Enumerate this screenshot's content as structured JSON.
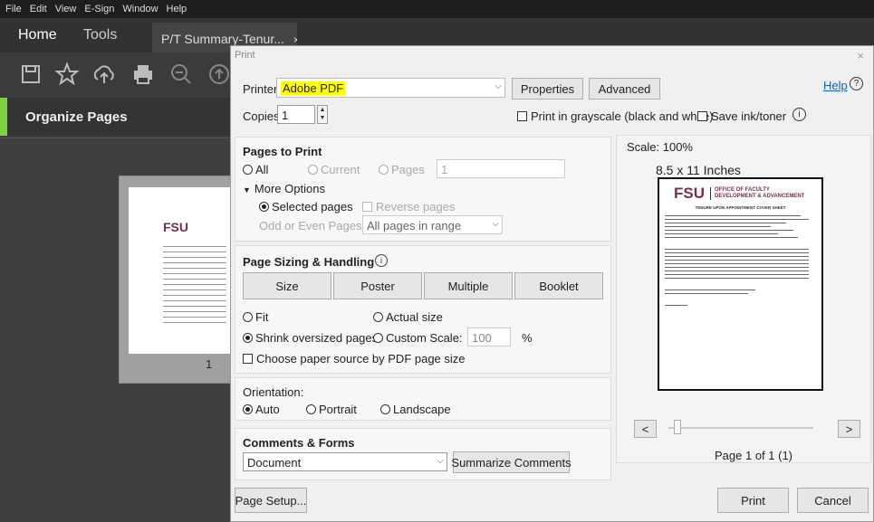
{
  "menubar": [
    "File",
    "Edit",
    "View",
    "E-Sign",
    "Window",
    "Help"
  ],
  "tabs": {
    "home": "Home",
    "tools": "Tools",
    "document": "P/T Summary-Tenur...",
    "close": "×"
  },
  "left_panel": {
    "title": "Organize Pages",
    "thumb_page_number": "1"
  },
  "dialog": {
    "title": "Print",
    "close": "×",
    "printer_label": "Printer:",
    "printer_value": "Adobe PDF",
    "properties": "Properties",
    "advanced": "Advanced",
    "help": "Help",
    "help_icon": "?",
    "copies_label": "Copies:",
    "copies_value": "1",
    "grayscale": "Print in grayscale (black and white)",
    "save_ink": "Save ink/toner",
    "info_icon": "i",
    "pages_to_print": {
      "title": "Pages to Print",
      "all": "All",
      "current": "Current",
      "pages": "Pages",
      "pages_value": "1",
      "more_options": "More Options",
      "selected_pages": "Selected pages",
      "reverse_pages": "Reverse pages",
      "odd_even_label": "Odd or Even Pages:",
      "odd_even_value": "All pages in range"
    },
    "sizing": {
      "title": "Page Sizing & Handling",
      "buttons": [
        "Size",
        "Poster",
        "Multiple",
        "Booklet"
      ],
      "fit": "Fit",
      "actual_size": "Actual size",
      "shrink": "Shrink oversized pages",
      "custom_scale": "Custom Scale:",
      "scale_value": "100",
      "percent": "%",
      "paper_source": "Choose paper source by PDF page size"
    },
    "orientation": {
      "title": "Orientation:",
      "auto": "Auto",
      "portrait": "Portrait",
      "landscape": "Landscape"
    },
    "comments": {
      "title": "Comments & Forms",
      "value": "Document",
      "summarize": "Summarize Comments"
    },
    "preview": {
      "scale": "Scale: 100%",
      "size": "8.5 x 11 Inches",
      "fsu": "FSU",
      "office_1": "OFFICE OF FACULTY",
      "office_2": "DEVELOPMENT & ADVANCEMENT",
      "cover": "TENURE UPON APPOINTMENT COVER SHEET",
      "prev": "<",
      "next": ">",
      "page_of": "Page 1 of 1 (1)"
    },
    "page_setup": "Page Setup...",
    "print": "Print",
    "cancel": "Cancel"
  },
  "colors": {
    "accent_green": "#7fd33f",
    "highlight": "#ffff00",
    "fsu_garnet": "#782f40"
  }
}
